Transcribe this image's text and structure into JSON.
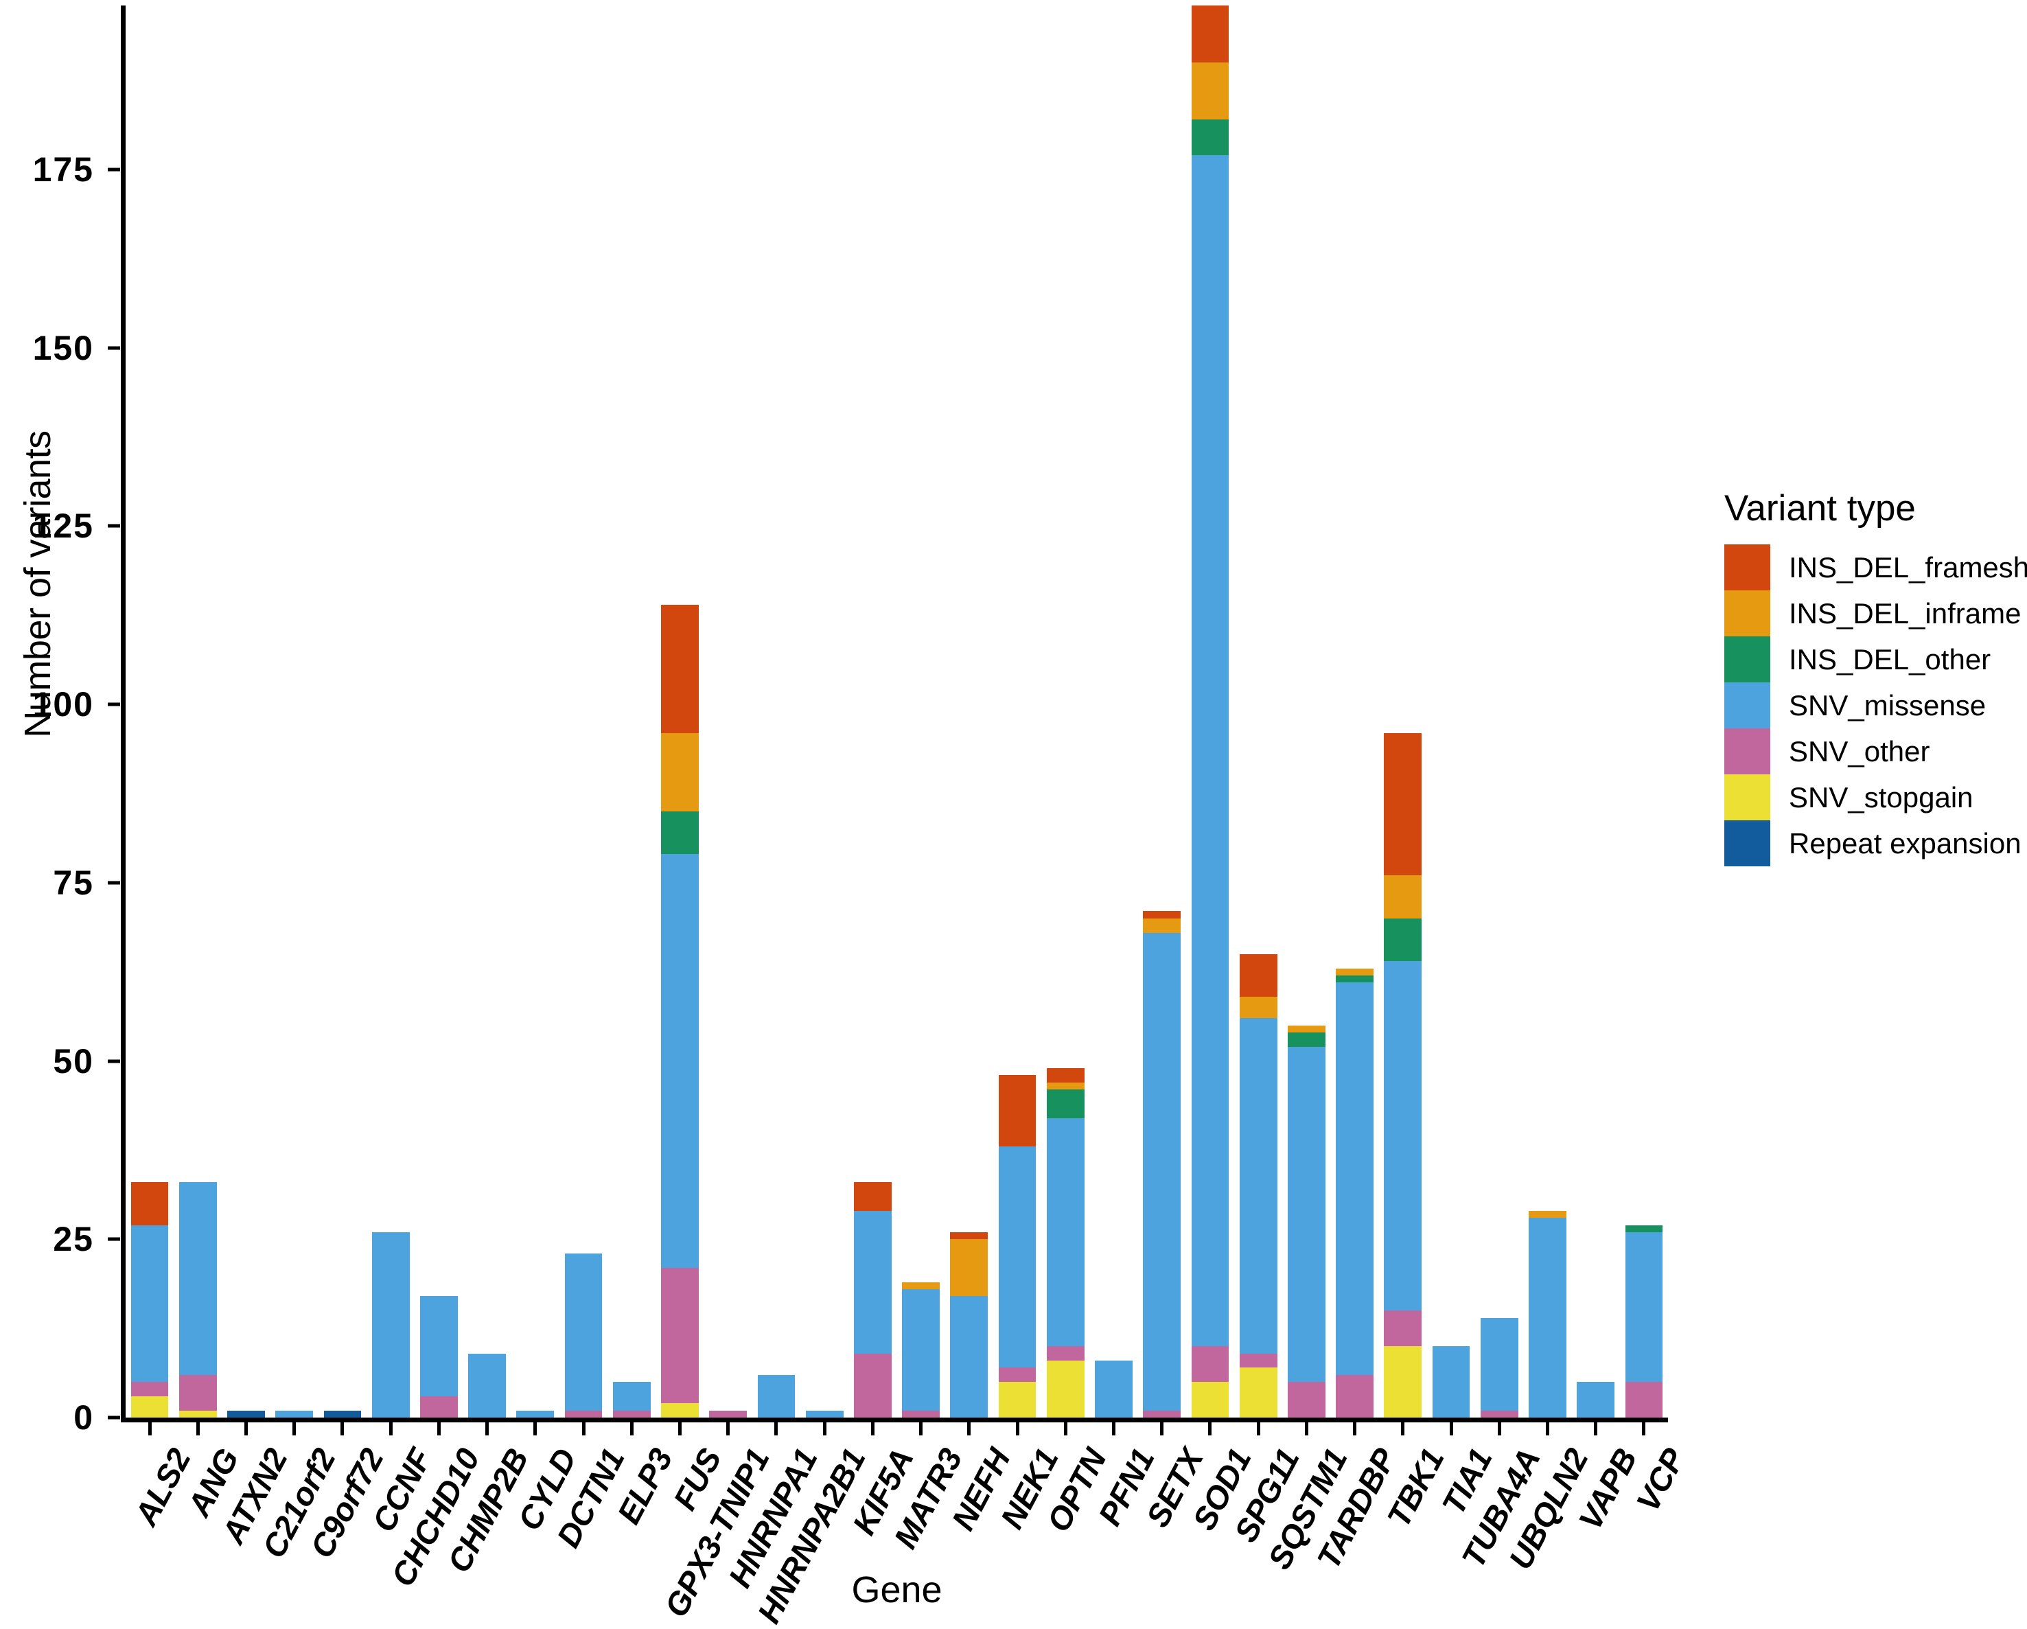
{
  "chart_data": {
    "type": "bar",
    "subtype": "stacked-bar",
    "title": "",
    "xlabel": "Gene",
    "ylabel": "Number of variants",
    "ylim": [
      0,
      198
    ],
    "yticks": [
      0,
      25,
      50,
      75,
      100,
      125,
      150,
      175
    ],
    "grid": false,
    "legend_title": "Variant type",
    "legend_position": "right",
    "stack_order_bottom_to_top": [
      "Repeat expansion",
      "SNV_stopgain",
      "SNV_other",
      "SNV_missense",
      "INS_DEL_other",
      "INS_DEL_inframe",
      "INS_DEL_frameshift"
    ],
    "colors": {
      "INS_DEL_frameshift": "#D1470D",
      "INS_DEL_inframe": "#E59A12",
      "INS_DEL_other": "#17915D",
      "SNV_missense": "#4CA3DE",
      "SNV_other": "#C1679E",
      "SNV_stopgain": "#EDE035",
      "Repeat expansion": "#125C9E"
    },
    "categories": [
      "ALS2",
      "ANG",
      "ATXN2",
      "C21orf2",
      "C9orf72",
      "CCNF",
      "CHCHD10",
      "CHMP2B",
      "CYLD",
      "DCTN1",
      "ELP3",
      "FUS",
      "GPX3-TNIP1",
      "HNRNPA1",
      "HNRNPA2B1",
      "KIF5A",
      "MATR3",
      "NEFH",
      "NEK1",
      "OPTN",
      "PFN1",
      "SETX",
      "SOD1",
      "SPG11",
      "SQSTM1",
      "TARDBP",
      "TBK1",
      "TIA1",
      "TUBA4A",
      "UBQLN2",
      "VAPB",
      "VCP"
    ],
    "series": [
      {
        "name": "Repeat expansion",
        "color": "#125C9E",
        "values": [
          0,
          0,
          1,
          0,
          1,
          0,
          0,
          0,
          0,
          0,
          0,
          0,
          0,
          0,
          0,
          0,
          0,
          0,
          0,
          0,
          0,
          0,
          0,
          0,
          0,
          0,
          0,
          0,
          0,
          0,
          0,
          0
        ]
      },
      {
        "name": "SNV_stopgain",
        "color": "#EDE035",
        "values": [
          3,
          1,
          0,
          0,
          0,
          0,
          0,
          0,
          0,
          0,
          0,
          2,
          0,
          0,
          0,
          0,
          0,
          0,
          5,
          8,
          0,
          0,
          5,
          7,
          0,
          0,
          10,
          0,
          0,
          0,
          0,
          0
        ]
      },
      {
        "name": "SNV_other",
        "color": "#C1679E",
        "values": [
          2,
          5,
          0,
          0,
          0,
          0,
          3,
          0,
          0,
          1,
          1,
          19,
          1,
          0,
          0,
          9,
          1,
          0,
          2,
          2,
          0,
          1,
          5,
          2,
          5,
          6,
          5,
          0,
          1,
          0,
          0,
          5
        ]
      },
      {
        "name": "SNV_missense",
        "color": "#4CA3DE",
        "values": [
          22,
          27,
          0,
          1,
          0,
          26,
          14,
          9,
          1,
          22,
          4,
          58,
          0,
          6,
          1,
          20,
          17,
          17,
          31,
          32,
          8,
          67,
          167,
          47,
          47,
          55,
          49,
          10,
          13,
          28,
          5,
          21
        ]
      },
      {
        "name": "INS_DEL_other",
        "color": "#17915D",
        "values": [
          0,
          0,
          0,
          0,
          0,
          0,
          0,
          0,
          0,
          0,
          0,
          6,
          0,
          0,
          0,
          0,
          0,
          0,
          0,
          4,
          0,
          0,
          5,
          0,
          2,
          1,
          6,
          0,
          0,
          0,
          0,
          1
        ]
      },
      {
        "name": "INS_DEL_inframe",
        "color": "#E59A12",
        "values": [
          0,
          0,
          0,
          0,
          0,
          0,
          0,
          0,
          0,
          0,
          0,
          11,
          0,
          0,
          0,
          0,
          1,
          8,
          0,
          1,
          0,
          2,
          8,
          3,
          1,
          1,
          6,
          0,
          0,
          1,
          0,
          0
        ]
      },
      {
        "name": "INS_DEL_frameshift",
        "color": "#D1470D",
        "values": [
          6,
          0,
          0,
          0,
          0,
          0,
          0,
          0,
          0,
          0,
          0,
          18,
          0,
          0,
          0,
          4,
          0,
          1,
          10,
          2,
          0,
          1,
          8,
          6,
          0,
          0,
          20,
          0,
          0,
          0,
          0,
          0
        ]
      }
    ],
    "totals": [
      33,
      33,
      1,
      1,
      1,
      26,
      17,
      9,
      1,
      23,
      5,
      114,
      1,
      6,
      1,
      33,
      19,
      26,
      48,
      49,
      8,
      71,
      198,
      65,
      55,
      63,
      96,
      10,
      14,
      29,
      5,
      27
    ]
  },
  "legend": {
    "title": "Variant type",
    "items": [
      {
        "label": "INS_DEL_frameshift",
        "color": "#D1470D"
      },
      {
        "label": "INS_DEL_inframe",
        "color": "#E59A12"
      },
      {
        "label": "INS_DEL_other",
        "color": "#17915D"
      },
      {
        "label": "SNV_missense",
        "color": "#4CA3DE"
      },
      {
        "label": "SNV_other",
        "color": "#C1679E"
      },
      {
        "label": "SNV_stopgain",
        "color": "#EDE035"
      },
      {
        "label": "Repeat expansion",
        "color": "#125C9E"
      }
    ]
  },
  "axes": {
    "x_title": "Gene",
    "y_title": "Number of variants"
  }
}
